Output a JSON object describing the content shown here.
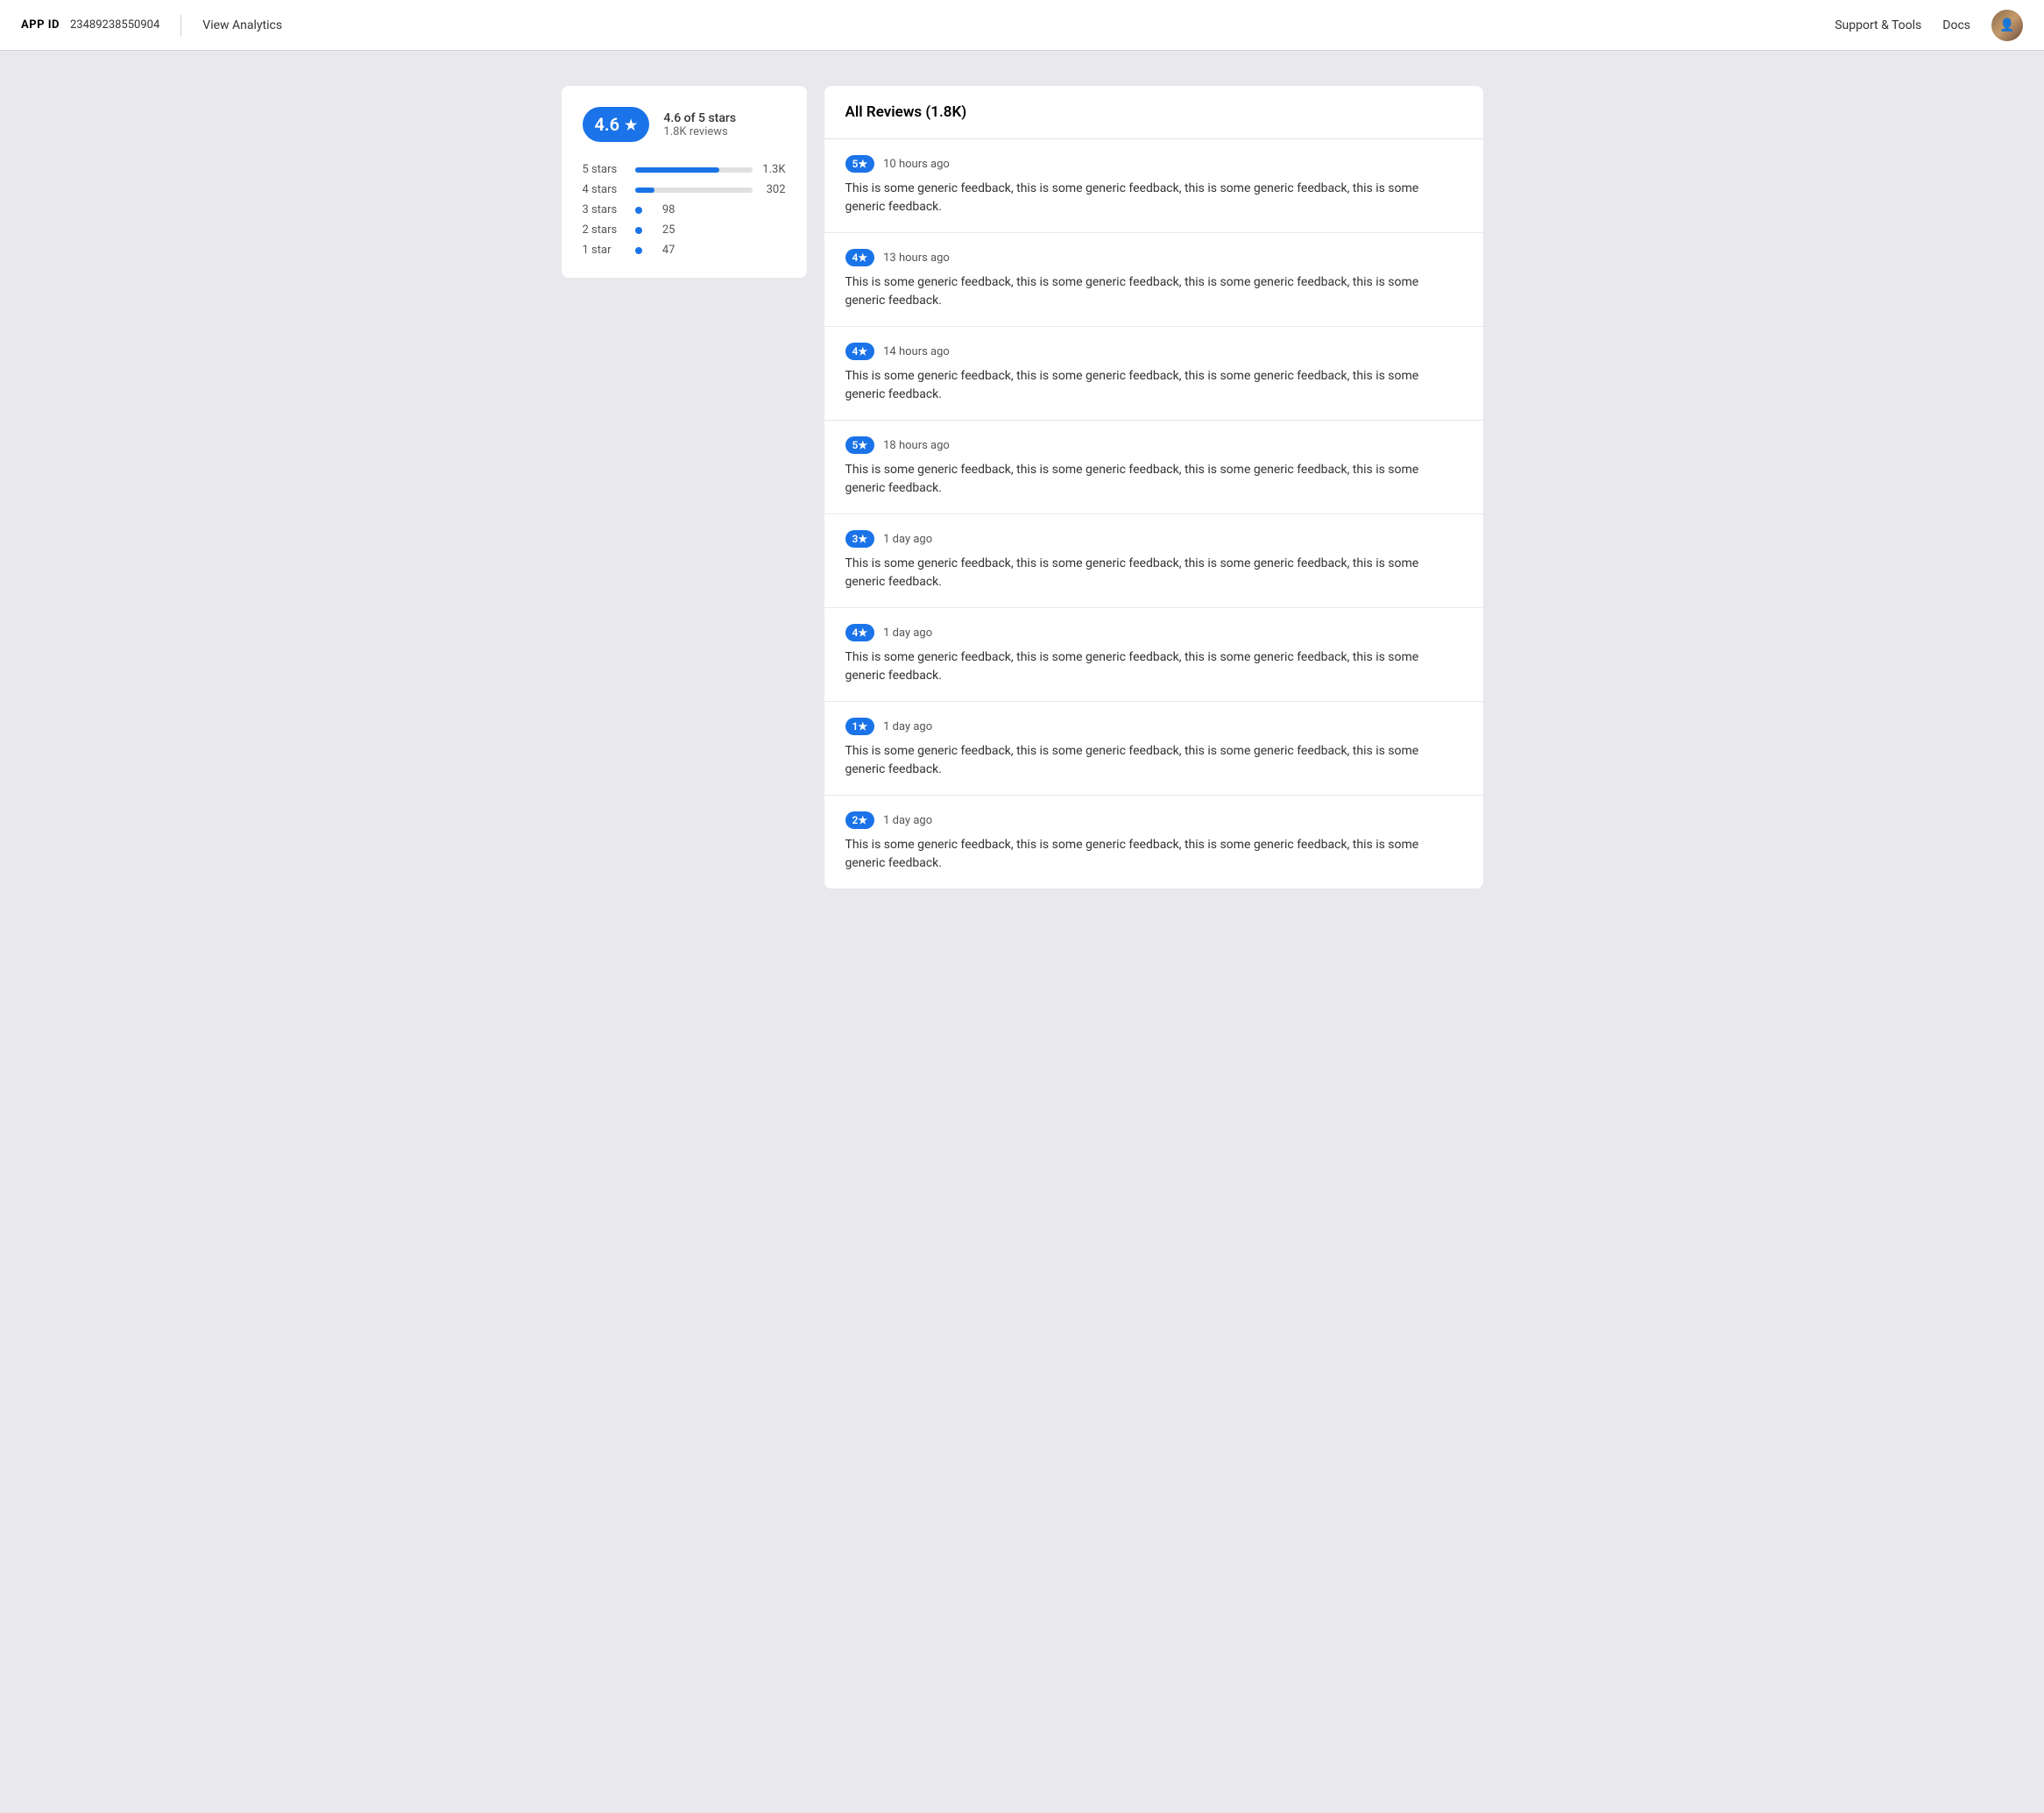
{
  "header": {
    "app_id_label": "APP ID",
    "app_id_value": "23489238550904",
    "view_analytics_label": "View Analytics",
    "support_tools_label": "Support & Tools",
    "docs_label": "Docs"
  },
  "rating_card": {
    "badge_value": "4.6",
    "badge_star": "★",
    "stars_text": "4.6 of 5 stars",
    "reviews_count": "1.8K reviews",
    "bars": [
      {
        "label": "5 stars",
        "count": "1.3K",
        "percent": 72,
        "type": "bar"
      },
      {
        "label": "4 stars",
        "count": "302",
        "percent": 17,
        "type": "bar"
      },
      {
        "label": "3 stars",
        "count": "98",
        "percent": 0,
        "type": "dot"
      },
      {
        "label": "2 stars",
        "count": "25",
        "percent": 0,
        "type": "dot"
      },
      {
        "label": "1 star",
        "count": "47",
        "percent": 0,
        "type": "dot"
      }
    ]
  },
  "reviews": {
    "header": "All Reviews (1.8K)",
    "items": [
      {
        "stars": "5",
        "time": "10 hours ago",
        "text": "This is some generic feedback, this is some generic feedback, this is some generic feedback, this is some generic feedback."
      },
      {
        "stars": "4",
        "time": "13 hours ago",
        "text": "This is some generic feedback, this is some generic feedback, this is some generic feedback, this is some generic feedback."
      },
      {
        "stars": "4",
        "time": "14 hours ago",
        "text": "This is some generic feedback, this is some generic feedback, this is some generic feedback, this is some generic feedback."
      },
      {
        "stars": "5",
        "time": "18 hours ago",
        "text": "This is some generic feedback, this is some generic feedback, this is some generic feedback, this is some generic feedback."
      },
      {
        "stars": "3",
        "time": "1 day ago",
        "text": "This is some generic feedback, this is some generic feedback, this is some generic feedback, this is some generic feedback."
      },
      {
        "stars": "4",
        "time": "1 day ago",
        "text": "This is some generic feedback, this is some generic feedback, this is some generic feedback, this is some generic feedback."
      },
      {
        "stars": "1",
        "time": "1 day ago",
        "text": "This is some generic feedback, this is some generic feedback, this is some generic feedback, this is some generic feedback."
      },
      {
        "stars": "2",
        "time": "1 day ago",
        "text": "This is some generic feedback, this is some generic feedback, this is some generic feedback, this is some generic feedback."
      }
    ]
  }
}
